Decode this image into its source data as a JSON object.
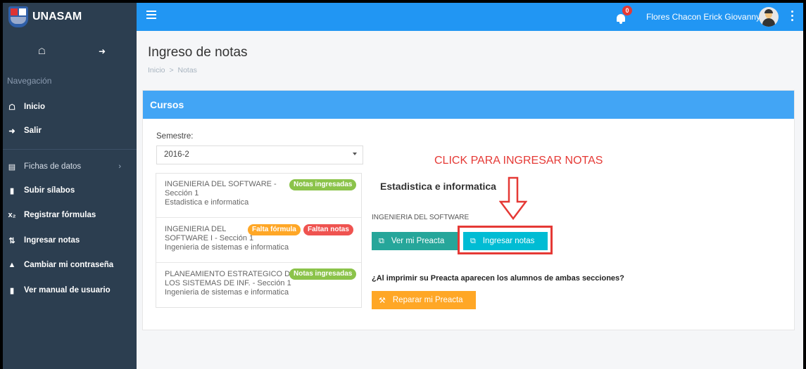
{
  "brand": {
    "name": "UNASAM"
  },
  "topbar": {
    "notifications_count": "0",
    "user_name": "Flores Chacon Erick Giovanny"
  },
  "sidebar": {
    "section_title": "Navegación",
    "items": [
      {
        "label": "Inicio",
        "icon": "home-icon"
      },
      {
        "label": "Salir",
        "icon": "sign-out-icon"
      },
      {
        "label": "Fichas de datos",
        "icon": "bar-chart-icon"
      },
      {
        "label": "Subir sílabos",
        "icon": "book-icon"
      },
      {
        "label": "Registrar fórmulas",
        "icon": "subscript-icon"
      },
      {
        "label": "Ingresar notas",
        "icon": "sort-numeric-icon"
      },
      {
        "label": "Cambiar mi contraseña",
        "icon": "lock-icon"
      },
      {
        "label": "Ver manual de usuario",
        "icon": "book-icon"
      }
    ]
  },
  "page": {
    "title": "Ingreso de notas",
    "breadcrumb": [
      "Inicio",
      "Notas"
    ],
    "breadcrumb_separator": ">"
  },
  "card": {
    "title": "Cursos",
    "semester_label": "Semestre:",
    "semester_value": "2016-2",
    "courses": [
      {
        "name": "INGENIERIA DEL SOFTWARE -",
        "section": "Sección 1",
        "career": "Estadistica e informatica",
        "badges": [
          {
            "label": "Notas ingresadas",
            "color": "#8bc34a"
          }
        ]
      },
      {
        "name": "INGENIERIA DEL",
        "section": "SOFTWARE I - Sección 1",
        "career": "Ingenieria de sistemas e informatica",
        "badges": [
          {
            "label": "Falta fórmula",
            "color": "#ffa726"
          },
          {
            "label": "Faltan notas",
            "color": "#ef5350"
          }
        ]
      },
      {
        "name": "PLANEAMIENTO ESTRATEGICO DE",
        "section": "LOS SISTEMAS DE INF. - Sección 1",
        "career": "Ingenieria de sistemas e informatica",
        "badges": [
          {
            "label": "Notas ingresadas",
            "color": "#8bc34a"
          }
        ]
      }
    ],
    "detail": {
      "title": "Estadistica e informatica",
      "course": "INGENIERIA DEL SOFTWARE",
      "btn_preacta": "Ver mi Preacta",
      "btn_ingresar": "Ingresar notas",
      "question": "¿Al imprimir su Preacta aparecen los alumnos de ambas secciones?",
      "btn_reparar": "Reparar mi Preacta"
    },
    "annotation": "CLICK PARA INGRESAR NOTAS"
  },
  "colors": {
    "sidebar": "#2c3e50",
    "topbar": "#2196f3",
    "card_header": "#42a5f5",
    "annotation": "#e53935"
  }
}
